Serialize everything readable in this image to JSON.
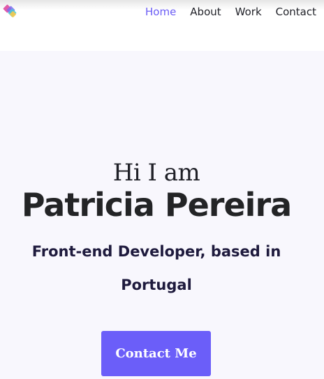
{
  "nav": {
    "items": [
      {
        "label": "Home",
        "active": true
      },
      {
        "label": "About",
        "active": false
      },
      {
        "label": "Work",
        "active": false
      },
      {
        "label": "Contact",
        "active": false
      }
    ]
  },
  "hero": {
    "greeting": "Hi I am",
    "name": "Patricia Pereira",
    "tagline": "Front-end Developer, based in Portugal",
    "cta_label": "Contact Me"
  },
  "colors": {
    "accent": "#6b5ef9",
    "nav_active": "#6a5cf5",
    "hero_bg": "#f8f7fd",
    "text_dark": "#232426"
  },
  "logo": {
    "icon": "diamond-logo-icon"
  }
}
